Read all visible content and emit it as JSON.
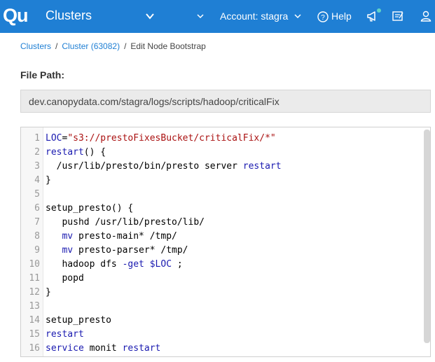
{
  "topbar": {
    "logo_text": "Qu",
    "title": "Clusters",
    "account": "Account: stagra",
    "help": "Help",
    "accent_color": "#1f7fd4",
    "notification_dot_color": "#5fd3c7"
  },
  "breadcrumb": {
    "items": [
      "Clusters",
      "Cluster (63082)",
      "Edit Node Bootstrap"
    ],
    "separator": "/"
  },
  "file_path": {
    "label": "File Path:",
    "value": "dev.canopydata.com/stagra/logs/scripts/hadoop/criticalFix"
  },
  "editor": {
    "line_numbers": [
      "1",
      "2",
      "3",
      "4",
      "5",
      "6",
      "7",
      "8",
      "9",
      "10",
      "11",
      "12",
      "13",
      "14",
      "15",
      "16"
    ],
    "lines": [
      [
        {
          "t": "LOC",
          "c": "var"
        },
        {
          "t": "=",
          "c": ""
        },
        {
          "t": "\"s3://prestoFixesBucket/criticalFix/*\"",
          "c": "str"
        }
      ],
      [
        {
          "t": "restart",
          "c": "kw"
        },
        {
          "t": "() {",
          "c": ""
        }
      ],
      [
        {
          "t": "  /usr/lib/presto/bin/presto server ",
          "c": ""
        },
        {
          "t": "restart",
          "c": "kw"
        }
      ],
      [
        {
          "t": "}",
          "c": ""
        }
      ],
      [
        {
          "t": "",
          "c": ""
        }
      ],
      [
        {
          "t": "setup_presto() {",
          "c": ""
        }
      ],
      [
        {
          "t": "   pushd /usr/lib/presto/lib/",
          "c": ""
        }
      ],
      [
        {
          "t": "   ",
          "c": ""
        },
        {
          "t": "mv",
          "c": "kw"
        },
        {
          "t": " presto-main* /tmp/",
          "c": ""
        }
      ],
      [
        {
          "t": "   ",
          "c": ""
        },
        {
          "t": "mv",
          "c": "kw"
        },
        {
          "t": " presto-parser* /tmp/",
          "c": ""
        }
      ],
      [
        {
          "t": "   hadoop dfs ",
          "c": ""
        },
        {
          "t": "-get",
          "c": "kw"
        },
        {
          "t": " ",
          "c": ""
        },
        {
          "t": "$LOC",
          "c": "var"
        },
        {
          "t": " ;",
          "c": ""
        }
      ],
      [
        {
          "t": "   popd",
          "c": ""
        }
      ],
      [
        {
          "t": "}",
          "c": ""
        }
      ],
      [
        {
          "t": "",
          "c": ""
        }
      ],
      [
        {
          "t": "setup_presto",
          "c": ""
        }
      ],
      [
        {
          "t": "restart",
          "c": "kw"
        }
      ],
      [
        {
          "t": "service",
          "c": "kw"
        },
        {
          "t": " monit ",
          "c": ""
        },
        {
          "t": "restart",
          "c": "kw"
        }
      ]
    ]
  }
}
